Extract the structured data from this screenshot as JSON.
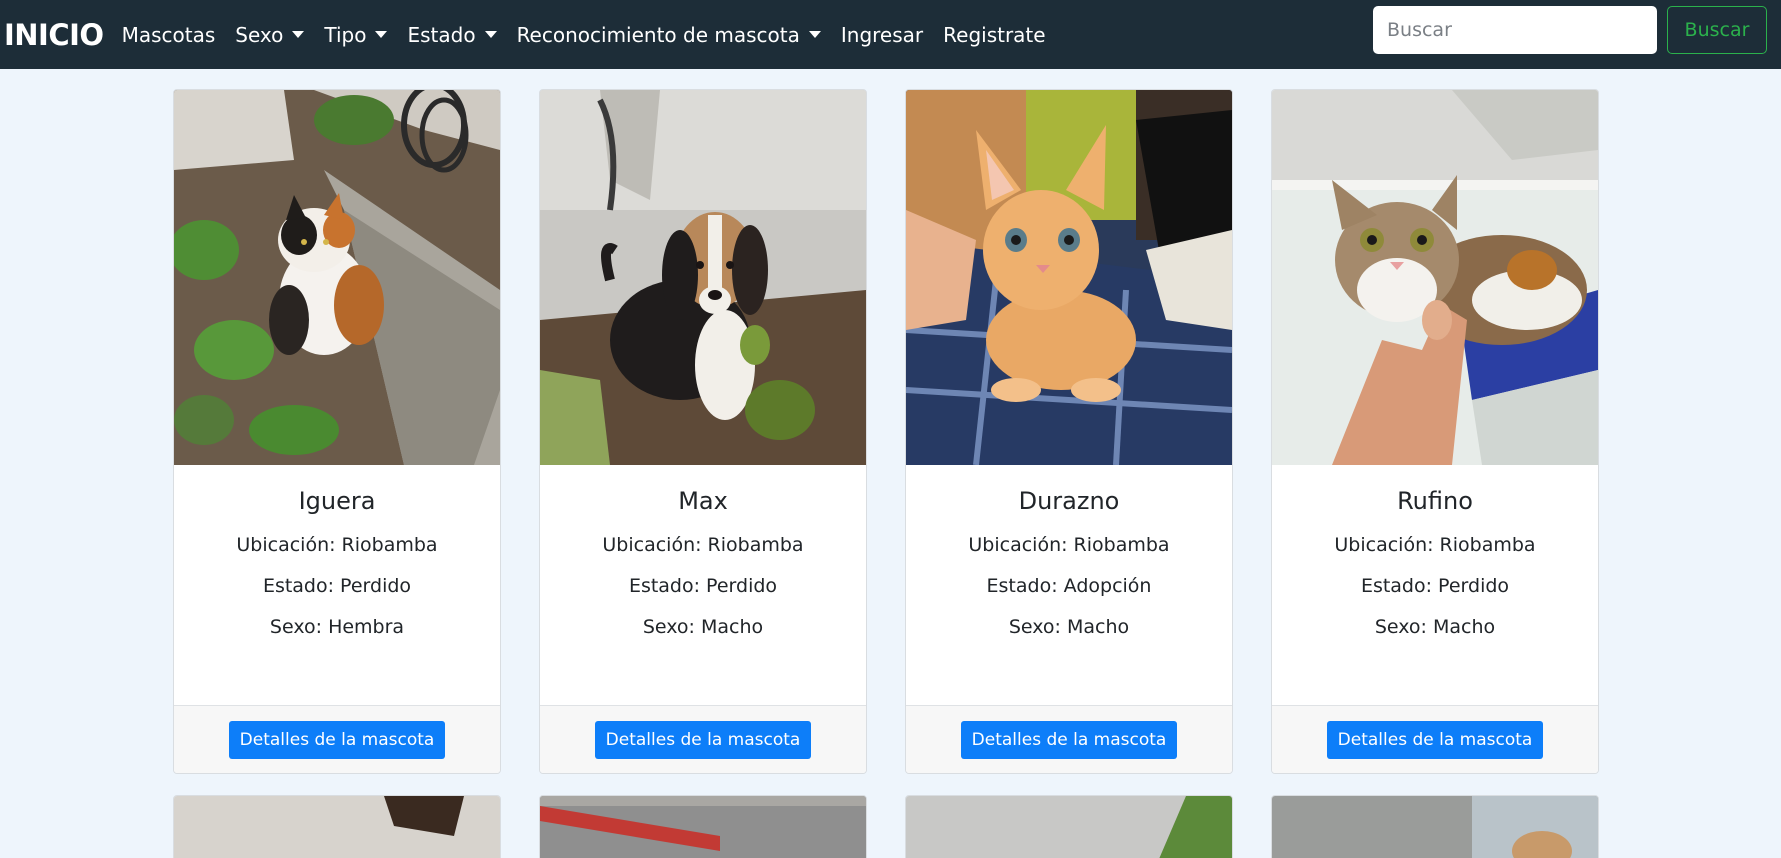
{
  "navbar": {
    "brand": "INICIO",
    "links": [
      {
        "label": "Mascotas",
        "dropdown": false
      },
      {
        "label": "Sexo",
        "dropdown": true
      },
      {
        "label": "Tipo",
        "dropdown": true
      },
      {
        "label": "Estado",
        "dropdown": true
      },
      {
        "label": "Reconocimiento de mascota",
        "dropdown": true
      },
      {
        "label": "Ingresar",
        "dropdown": false
      },
      {
        "label": "Registrate",
        "dropdown": false
      }
    ],
    "search_placeholder": "Buscar",
    "search_button": "Buscar"
  },
  "pets": [
    {
      "name": "Iguera",
      "location": "Ubicación: Riobamba",
      "status": "Estado: Perdido",
      "sex": "Sexo: Hembra",
      "button": "Detalles de la mascota",
      "photo": "calico-cat-in-garden"
    },
    {
      "name": "Max",
      "location": "Ubicación: Riobamba",
      "status": "Estado: Perdido",
      "sex": "Sexo: Macho",
      "button": "Detalles de la mascota",
      "photo": "beagle-puppy-in-soil"
    },
    {
      "name": "Durazno",
      "location": "Ubicación: Riobamba",
      "status": "Estado: Adopción",
      "sex": "Sexo: Macho",
      "button": "Detalles de la mascota",
      "photo": "orange-kitten-on-blanket"
    },
    {
      "name": "Rufino",
      "location": "Ubicación: Riobamba",
      "status": "Estado: Perdido",
      "sex": "Sexo: Macho",
      "button": "Detalles de la mascota",
      "photo": "tabby-white-cat-held"
    }
  ],
  "colors": {
    "navbar": "#1d2d38",
    "page_background": "#eef5fc",
    "primary_button": "#0d7ef9",
    "search_button": "#2bb14c"
  }
}
